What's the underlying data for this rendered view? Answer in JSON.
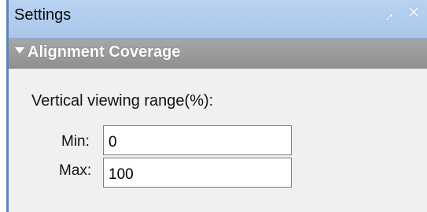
{
  "window": {
    "title": "Settings",
    "pin_glyph": "➚",
    "close_glyph": "✕"
  },
  "section": {
    "title": "Alignment Coverage"
  },
  "form": {
    "range_label": "Vertical viewing range(%):",
    "min_label": "Min:",
    "min_value": "0",
    "max_label": "Max:",
    "max_value": "100"
  },
  "colors": {
    "titlebar": "#b9d3f1",
    "section_header": "#999999",
    "panel_bg": "#f0f0f0"
  }
}
